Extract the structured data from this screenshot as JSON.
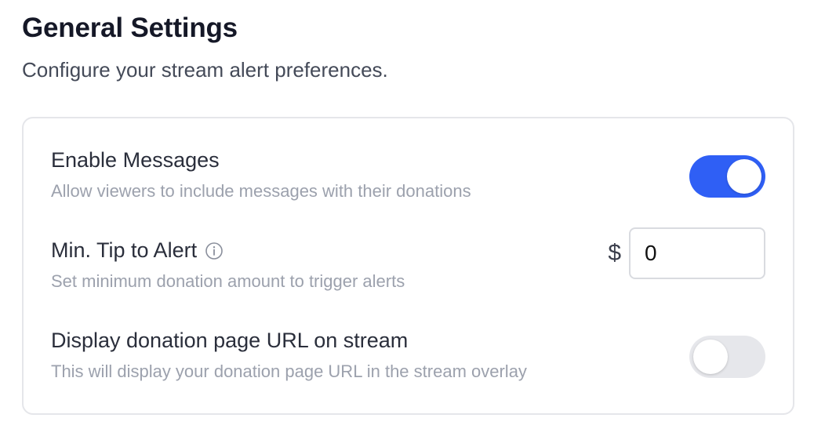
{
  "header": {
    "title": "General Settings",
    "subtitle": "Configure your stream alert preferences."
  },
  "settings": {
    "enable_messages": {
      "label": "Enable Messages",
      "description": "Allow viewers to include messages with their donations",
      "enabled": true
    },
    "min_tip": {
      "label": "Min. Tip to Alert",
      "description": "Set minimum donation amount to trigger alerts",
      "currency_symbol": "$",
      "value": "0",
      "info_icon": "info-circle-icon"
    },
    "display_url": {
      "label": "Display donation page URL on stream",
      "description": "This will display your donation page URL in the stream overlay",
      "enabled": false
    }
  },
  "colors": {
    "accent": "#2f5ff5",
    "toggle_off": "#e6e7eb",
    "title": "#151827",
    "muted": "#9ca1ad"
  }
}
